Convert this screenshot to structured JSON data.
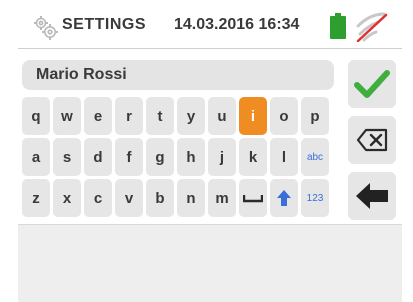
{
  "header": {
    "title": "SETTINGS",
    "datetime": "14.03.2016 16:34",
    "icons": {
      "settings": "gear-icon",
      "battery": "battery-icon",
      "wifi": "wifi-off-icon"
    }
  },
  "text_field": {
    "value": "Mario Rossi"
  },
  "keyboard": {
    "row1": [
      "q",
      "w",
      "e",
      "r",
      "t",
      "y",
      "u",
      "i",
      "o",
      "p"
    ],
    "row2": [
      "a",
      "s",
      "d",
      "f",
      "g",
      "h",
      "j",
      "k",
      "l",
      "abc"
    ],
    "row3": [
      "z",
      "x",
      "c",
      "v",
      "b",
      "n",
      "m",
      "",
      "",
      "123"
    ],
    "active_key": "i",
    "space_key_icon": "space-bar-icon",
    "shift_key_icon": "shift-arrow-icon"
  },
  "side_buttons": {
    "confirm": "checkmark-icon",
    "backspace": "backspace-icon",
    "back": "back-arrow-icon"
  },
  "colors": {
    "accent": "#ef8c22",
    "confirm_green": "#3fae3f",
    "battery_green": "#2e9e2e",
    "wifi_slash_red": "#e03030",
    "key_bg": "#e6e6e6",
    "label_blue": "#3b6fd8"
  }
}
